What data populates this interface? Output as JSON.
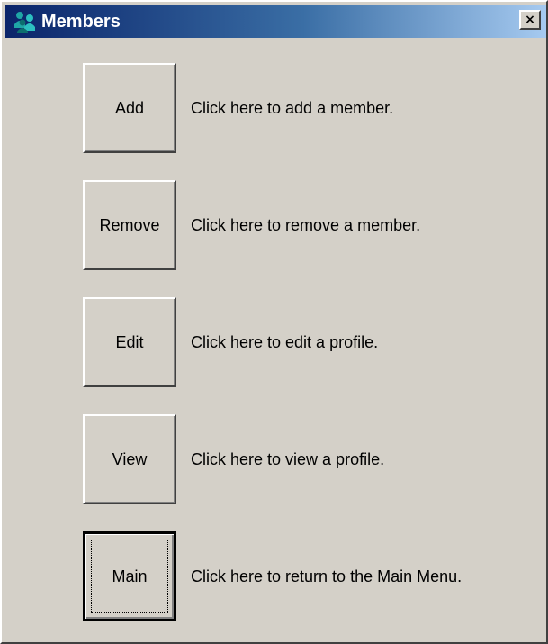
{
  "window": {
    "title": "Members",
    "close_label": "×",
    "icon": "members-app-icon"
  },
  "colors": {
    "titlebar_start": "#0a246a",
    "titlebar_end": "#a6caf0",
    "face": "#d4d0c8"
  },
  "actions": [
    {
      "label": "Add",
      "description": "Click here to add a member."
    },
    {
      "label": "Remove",
      "description": "Click here to remove a member."
    },
    {
      "label": "Edit",
      "description": "Click here to edit a profile."
    },
    {
      "label": "View",
      "description": "Click here to view a profile."
    },
    {
      "label": "Main",
      "description": "Click here to return to the Main Menu.",
      "default": true
    }
  ]
}
